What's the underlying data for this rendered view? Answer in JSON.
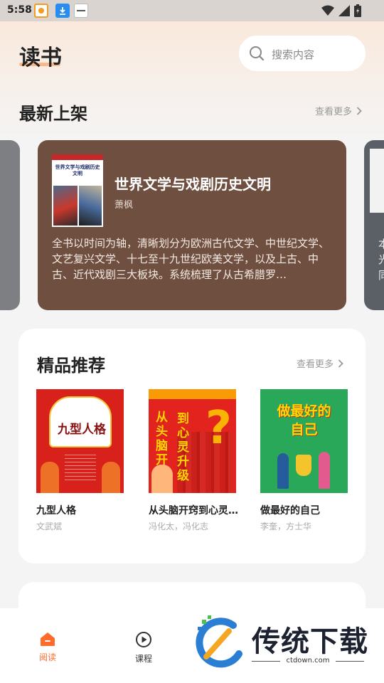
{
  "status_bar": {
    "time": "5:58"
  },
  "header": {
    "title": "读书",
    "search_placeholder": "搜索内容"
  },
  "new_arrivals": {
    "title": "最新上架",
    "more_label": "查看更多",
    "featured": {
      "cover_text": "世界文学与戏剧历史文明",
      "title": "世界文学与戏剧历史文明",
      "author": "萧枫",
      "description": "全书以时间为轴，清晰划分为欧洲古代文学、中世纪文学、文艺复兴文学、十七至十九世纪欧美文学，以及上古、中古、近代戏剧三大板块。系统梳理了从古希腊罗…"
    },
    "next_card_peek": [
      "本",
      "光",
      "同"
    ]
  },
  "recommended": {
    "title": "精品推荐",
    "more_label": "查看更多",
    "books": [
      {
        "title": "九型人格",
        "author": "文武斌",
        "cover_text": "九型人格"
      },
      {
        "title": "从头脑开窍到心灵…",
        "author": "冯化太，冯化志",
        "cover_text_a": "从头脑开窍",
        "cover_text_b": "到心灵升级"
      },
      {
        "title": "做最好的自己",
        "author": "李奎，方士华",
        "cover_text_a": "做最好的",
        "cover_text_b": "自己"
      }
    ]
  },
  "tabs": [
    {
      "label": "阅读",
      "active": true
    },
    {
      "label": "课程",
      "active": false
    }
  ],
  "watermark": {
    "text": "传统下载",
    "url": "ctdown.com"
  },
  "colors": {
    "accent": "#ff6b2c",
    "featured_bg": "#6f5040"
  }
}
